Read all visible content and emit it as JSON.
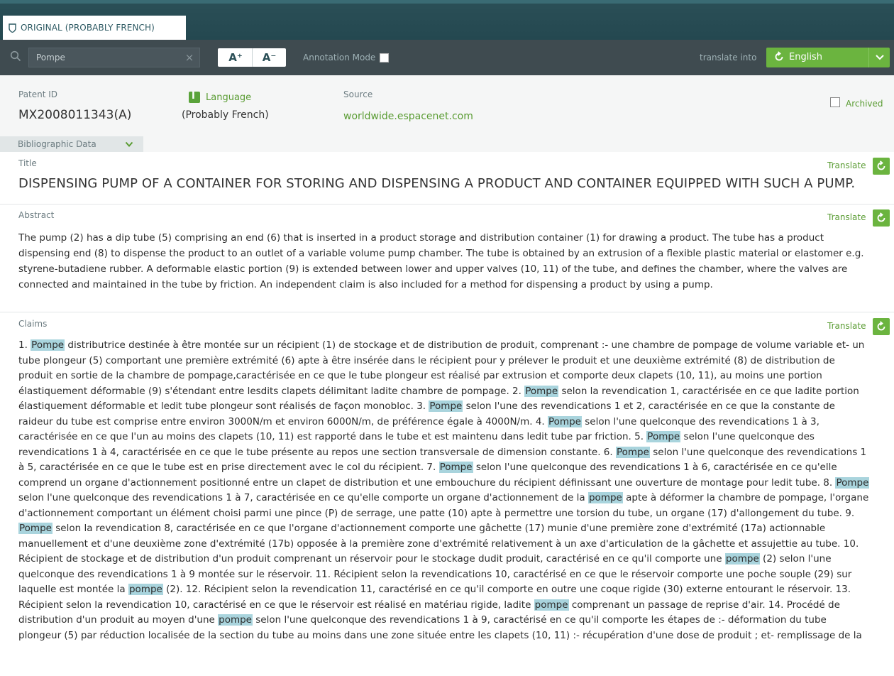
{
  "tab": {
    "label": "ORIGINAL (PROBABLY FRENCH)"
  },
  "toolbar": {
    "search_value": "Pompe",
    "font_increase_label": "A⁺",
    "font_decrease_label": "A⁻",
    "annotation_label": "Annotation Mode",
    "translate_into_label": "translate into",
    "language_selected": "English"
  },
  "meta": {
    "patent_id_label": "Patent ID",
    "patent_id": "MX2008011343(A)",
    "language_label": "Language",
    "language_value": "(Probably French)",
    "source_label": "Source",
    "source_value": "worldwide.espacenet.com",
    "archived_label": "Archived",
    "bibliographic_label": "Bibliographic Data"
  },
  "title_section": {
    "label": "Title",
    "translate_label": "Translate",
    "text": "DISPENSING PUMP OF A CONTAINER FOR STORING AND DISPENSING A PRODUCT AND CONTAINER EQUIPPED WITH SUCH A PUMP."
  },
  "abstract_section": {
    "label": "Abstract",
    "translate_label": "Translate",
    "text": "The pump (2) has a dip tube (5) comprising an end (6) that is inserted in a product storage and distribution container (1) for drawing a product. The tube has a product dispensing end (8) to dispense the product to an outlet of a variable volume pump chamber. The tube is obtained by an extrusion of a flexible plastic material or elastomer e.g. styrene-butadiene rubber. A deformable elastic portion (9) is extended between lower and upper valves (10, 11) of the tube, and defines the chamber, where the valves are connected and maintained in the tube by friction. An independent claim is also included for a method for dispensing a product by using a pump."
  },
  "claims_section": {
    "label": "Claims",
    "translate_label": "Translate",
    "highlight_term": "Pompe",
    "text": "1. Pompe distributrice destinée à être montée sur un récipient (1) de stockage et de distribution de produit, comprenant :- une chambre de pompage de volume variable et- un tube plongeur (5) comportant une première extrémité (6) apte à être insérée dans le récipient pour y prélever le produit et une deuxième extrémité (8) de distribution de produit en sortie de la chambre de pompage,caractérisée en ce que le tube plongeur est réalisé par extrusion et comporte deux clapets (10, 11), au moins une portion élastiquement déformable (9) s'étendant entre lesdits clapets délimitant ladite chambre de pompage. 2. Pompe selon la revendication 1, caractérisée en ce que ladite portion élastiquement déformable et ledit tube plongeur sont réalisés de façon monobloc. 3. Pompe selon l'une des revendications 1 et 2, caractérisée en ce que la constante de raideur du tube est comprise entre environ 3000N/m et environ 6000N/m, de préférence égale à 4000N/m. 4. Pompe selon l'une quelconque des revendications 1 à 3, caractérisée en ce que l'un au moins des clapets (10, 11) est rapporté dans le tube et est maintenu dans ledit tube par friction. 5. Pompe selon l'une quelconque des revendications 1 à 4, caractérisée en ce que le tube présente au repos une section transversale de dimension constante. 6. Pompe selon l'une quelconque des revendications 1 à 5, caractérisée en ce que le tube est en prise directement avec le col du récipient. 7. Pompe selon l'une quelconque des revendications 1 à 6, caractérisée en ce qu'elle comprend un organe d'actionnement positionné entre un clapet de distribution et une embouchure du récipient définissant une ouverture de montage pour ledit tube. 8. Pompe selon l'une quelconque des revendications 1 à 7, caractérisée en ce qu'elle comporte un organe d'actionnement de la pompe apte à déformer la chambre de pompage, l'organe d'actionnement comportant un élément choisi parmi une pince (P) de serrage, une patte (10) apte à permettre une torsion du tube, un organe (17) d'allongement du tube. 9. Pompe selon la revendication 8, caractérisée en ce que l'organe d'actionnement comporte une gâchette (17) munie d'une première zone d'extrémité (17a) actionnable manuellement et d'une deuxième zone d'extrémité (17b) opposée à la première zone d'extrémité relativement à un axe d'articulation de la gâchette et assujettie au tube. 10. Récipient de stockage et de distribution d'un produit comprenant un réservoir pour le stockage dudit produit, caractérisé en ce qu'il comporte une pompe (2) selon l'une quelconque des revendications 1 à 9 montée sur le réservoir. 11. Récipient selon la revendications 10, caractérisé en ce que le réservoir comporte une poche souple (29) sur laquelle est montée la pompe (2). 12. Récipient selon la revendication 11, caractérisé en ce qu'il comporte en outre une coque rigide (30) externe entourant le réservoir. 13. Récipient selon la revendication 10, caractérisé en ce que le réservoir est réalisé en matériau rigide, ladite pompe comprenant un passage de reprise d'air. 14. Procédé de distribution d'un produit au moyen d'une pompe selon l'une quelconque des revendications 1 à 9, caractérisé en ce qu'il comporte les étapes de :- déformation du tube plongeur (5) par réduction localisée de la section du tube au moins dans une zone située entre les clapets (10, 11) :- récupération d'une dose de produit ; et- remplissage de la"
  }
}
